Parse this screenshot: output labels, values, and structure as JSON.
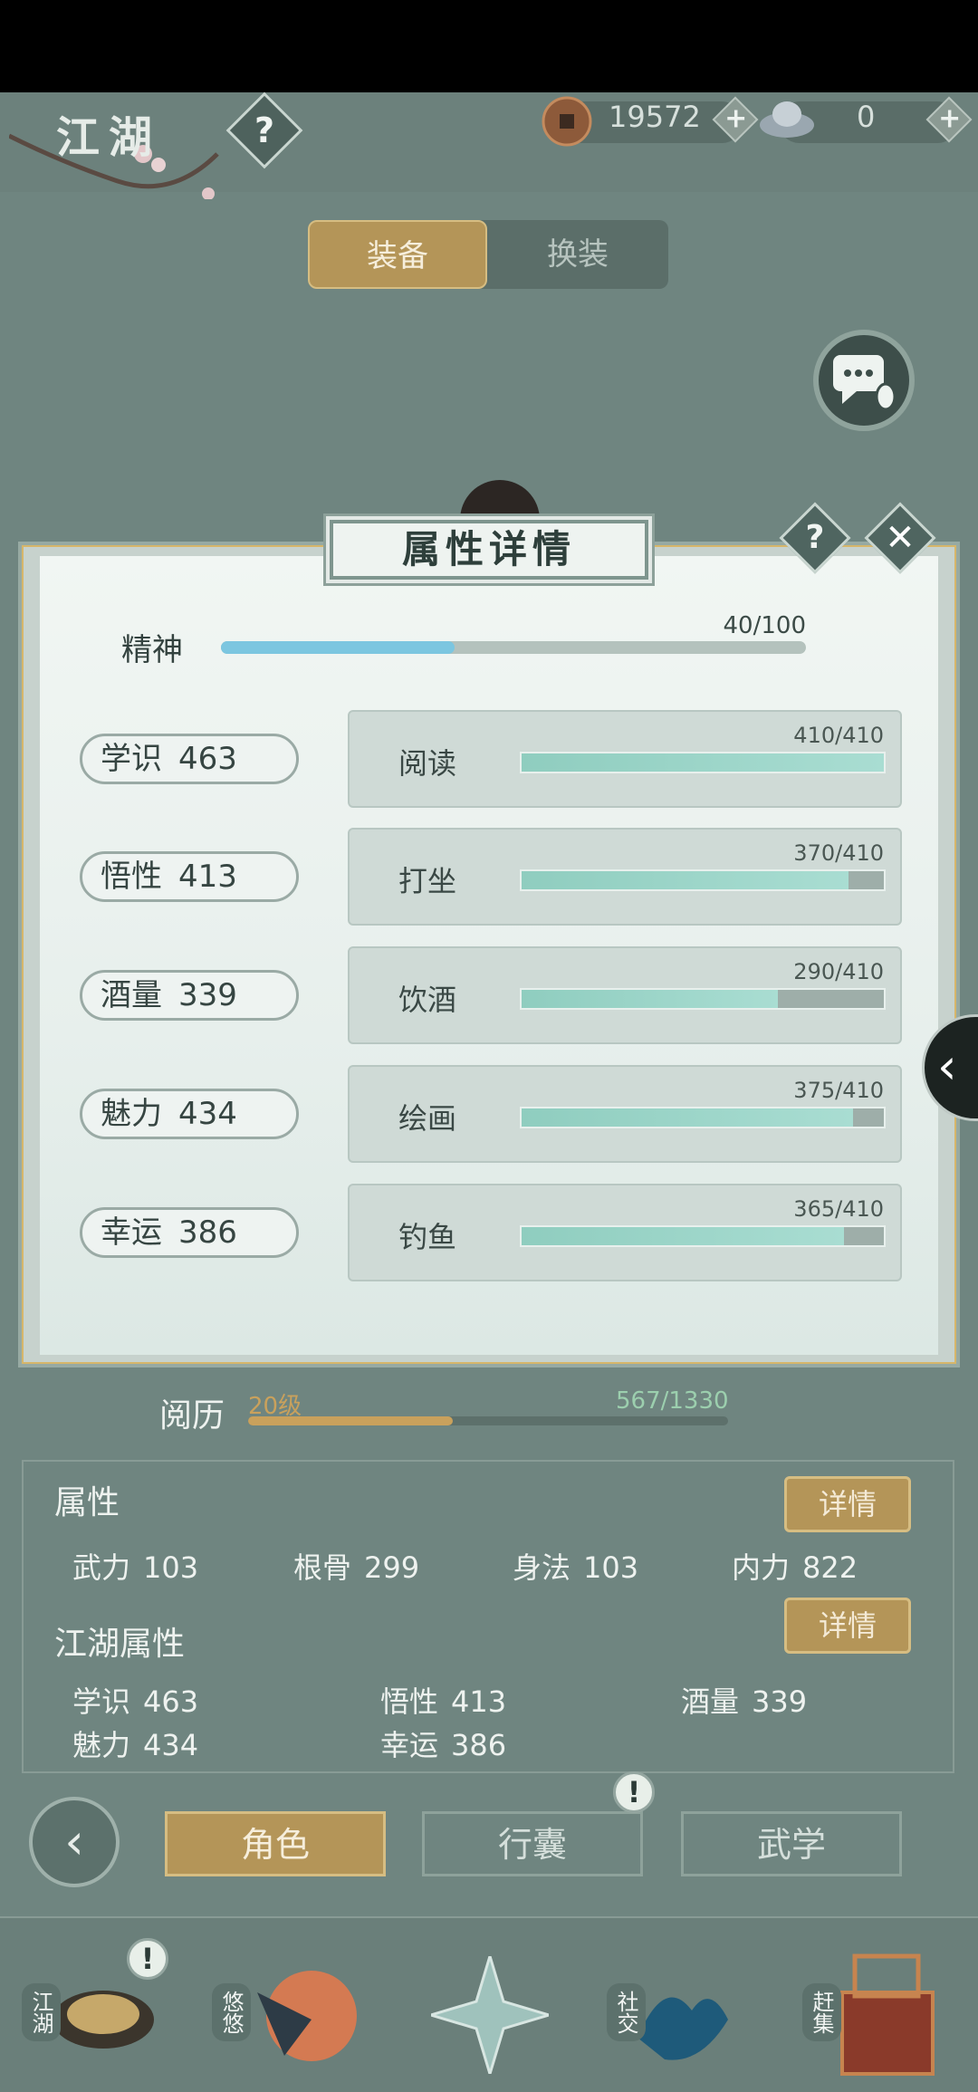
{
  "header": {
    "title": "江湖",
    "help_symbol": "?",
    "coins": "19572",
    "silver": "0",
    "plus_symbol": "+"
  },
  "tabs": [
    {
      "label": "装备",
      "active": true
    },
    {
      "label": "换装",
      "active": false
    }
  ],
  "dialog": {
    "title": "属性详情",
    "help_symbol": "?",
    "close_symbol": "✕",
    "spirit": {
      "label": "精神",
      "value_text": "40/100",
      "fraction": 0.4
    },
    "stats": [
      {
        "name": "学识",
        "value": "463",
        "activity": "阅读",
        "progress_text": "410/410",
        "fraction": 1.0
      },
      {
        "name": "悟性",
        "value": "413",
        "activity": "打坐",
        "progress_text": "370/410",
        "fraction": 0.902
      },
      {
        "name": "酒量",
        "value": "339",
        "activity": "饮酒",
        "progress_text": "290/410",
        "fraction": 0.707
      },
      {
        "name": "魅力",
        "value": "434",
        "activity": "绘画",
        "progress_text": "375/410",
        "fraction": 0.915
      },
      {
        "name": "幸运",
        "value": "386",
        "activity": "钓鱼",
        "progress_text": "365/410",
        "fraction": 0.89
      }
    ]
  },
  "experience": {
    "label": "阅历",
    "level": "20级",
    "value_text": "567/1330",
    "fraction": 0.426
  },
  "attributes": {
    "title": "属性",
    "detail_label": "详情",
    "items": [
      {
        "name": "武力",
        "value": "103"
      },
      {
        "name": "根骨",
        "value": "299"
      },
      {
        "name": "身法",
        "value": "103"
      },
      {
        "name": "内力",
        "value": "822"
      }
    ]
  },
  "jianghu_attributes": {
    "title": "江湖属性",
    "detail_label": "详情",
    "items": [
      {
        "name": "学识",
        "value": "463"
      },
      {
        "name": "悟性",
        "value": "413"
      },
      {
        "name": "酒量",
        "value": "339"
      },
      {
        "name": "魅力",
        "value": "434"
      },
      {
        "name": "幸运",
        "value": "386"
      }
    ]
  },
  "bottom_nav": {
    "back_symbol": "‹",
    "buttons": [
      {
        "label": "角色",
        "active": true
      },
      {
        "label": "行囊",
        "active": false
      },
      {
        "label": "武学",
        "active": false
      }
    ],
    "alert_symbol": "!"
  },
  "dock": [
    {
      "label": "江湖"
    },
    {
      "label": "悠悠"
    },
    {
      "label": ""
    },
    {
      "label": "社交"
    },
    {
      "label": "赶集"
    }
  ],
  "side_arrow_symbol": "‹",
  "colors": {
    "accent_gold": "#b49558",
    "panel_bg": "#e7efec",
    "progress_teal": "#8fcdbf",
    "spirit_blue": "#7cc6e0",
    "page_bg": "#6f8580"
  }
}
